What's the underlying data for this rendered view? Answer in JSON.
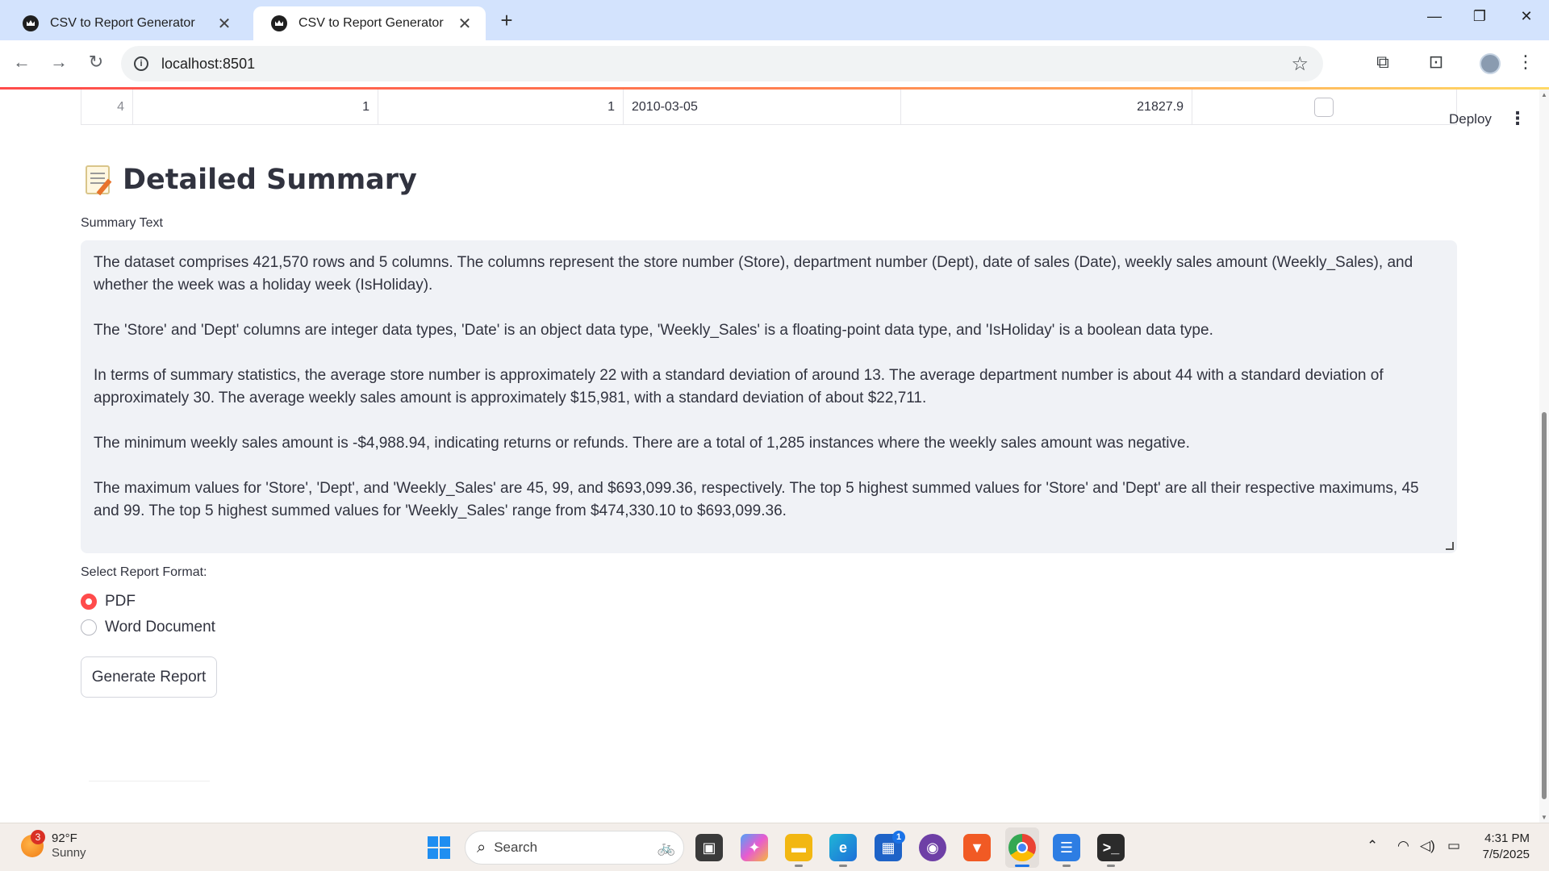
{
  "browser": {
    "tabs": [
      {
        "title": "CSV to Report Generator",
        "active": false
      },
      {
        "title": "CSV to Report Generator",
        "active": true
      }
    ],
    "url": "localhost:8501"
  },
  "app_header": {
    "deploy_label": "Deploy",
    "menu_icon": "⋮"
  },
  "table_row": {
    "index": "4",
    "store": "1",
    "dept": "1",
    "date": "2010-03-05",
    "weekly_sales": "21827.9",
    "is_holiday_checked": false
  },
  "section": {
    "title": "Detailed Summary",
    "summary_label": "Summary Text",
    "paragraphs": [
      "The dataset comprises 421,570 rows and 5 columns. The columns represent the store number (Store), department number (Dept), date of sales (Date), weekly sales amount (Weekly_Sales), and whether the week was a holiday week (IsHoliday).",
      "The 'Store' and 'Dept' columns are integer data types, 'Date' is an object data type, 'Weekly_Sales' is a floating-point data type, and 'IsHoliday' is a boolean data type.",
      "In terms of summary statistics, the average store number is approximately 22 with a standard deviation of around 13. The average department number is about 44 with a standard deviation of approximately 30. The average weekly sales amount is approximately $15,981, with a standard deviation of about $22,711.",
      "The minimum weekly sales amount is -$4,988.94, indicating returns or refunds. There are a total of 1,285 instances where the weekly sales amount was negative.",
      "The maximum values for 'Store', 'Dept', and 'Weekly_Sales' are 45, 99, and $693,099.36, respectively. The top 5 highest summed values for 'Store' and 'Dept' are all their respective maximums, 45 and 99. The top 5 highest summed values for 'Weekly_Sales' range from $474,330.10 to $693,099.36."
    ]
  },
  "report_format": {
    "label": "Select Report Format:",
    "options": [
      "PDF",
      "Word Document"
    ],
    "selected": "PDF"
  },
  "generate_button": "Generate Report",
  "taskbar": {
    "weather_badge": "3",
    "temperature": "92°F",
    "condition": "Sunny",
    "search_placeholder": "Search",
    "store_badge": "1",
    "time": "4:31 PM",
    "date": "7/5/2025"
  }
}
